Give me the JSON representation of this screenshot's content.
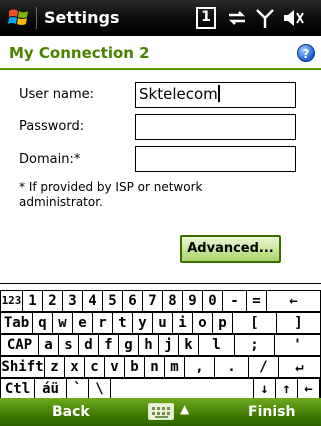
{
  "title_bar": {
    "app_title": "Settings",
    "start_icon": "windows-flag-icon",
    "status_icons": [
      "notification-one-icon",
      "sync-icon",
      "signal-icon",
      "volume-icon"
    ],
    "notification_text": "1"
  },
  "header": {
    "page_title": "My Connection 2",
    "help_icon": "help-icon",
    "help_glyph": "?"
  },
  "form": {
    "username_label": "User name:",
    "username_value": "Sktelecom",
    "password_label": "Password:",
    "password_value": "",
    "domain_label": "Domain:*",
    "domain_value": "",
    "note": "* If provided by ISP or network administrator.",
    "advanced_label": "Advanced..."
  },
  "keyboard": {
    "rows": [
      [
        "123",
        "1",
        "2",
        "3",
        "4",
        "5",
        "6",
        "7",
        "8",
        "9",
        "0",
        "-",
        "=",
        "←"
      ],
      [
        "Tab",
        "q",
        "w",
        "e",
        "r",
        "t",
        "y",
        "u",
        "i",
        "o",
        "p",
        "[",
        "]"
      ],
      [
        "CAP",
        "a",
        "s",
        "d",
        "f",
        "g",
        "h",
        "j",
        "k",
        "l",
        ";",
        "'"
      ],
      [
        "Shift",
        "z",
        "x",
        "c",
        "v",
        "b",
        "n",
        "m",
        ",",
        ".",
        "/",
        "↵"
      ],
      [
        "Ctl",
        "áü",
        "`",
        "\\",
        "",
        "↓",
        "↑",
        "←",
        "→"
      ]
    ]
  },
  "soft_keys": {
    "left": "Back",
    "right": "Finish",
    "center_icon": "keyboard-icon",
    "up_arrow": "▲"
  },
  "colors": {
    "accent_green": "#4c8000",
    "softbar_green": "#3f7a00",
    "title_bar_black": "#000000"
  }
}
